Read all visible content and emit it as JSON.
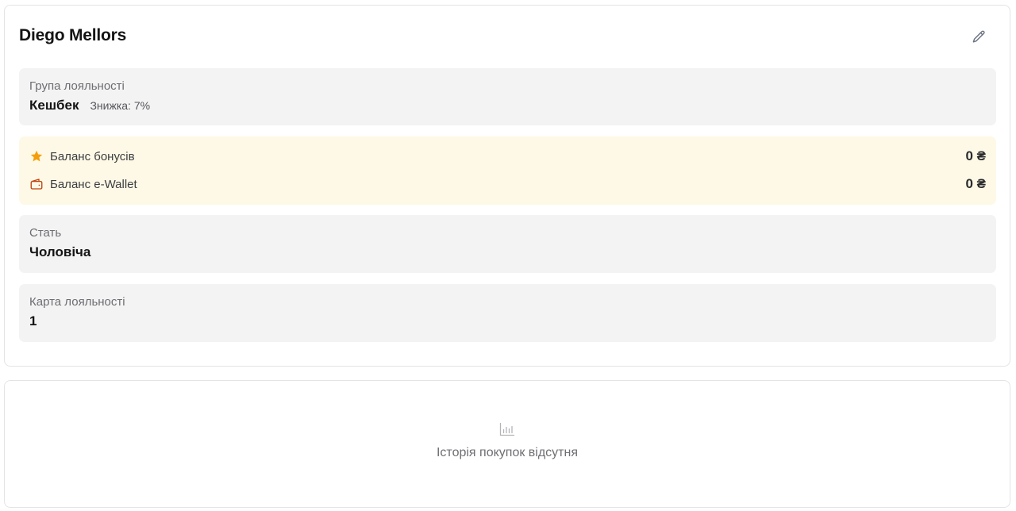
{
  "customer": {
    "name": "Diego Mellors",
    "edit_icon": "pencil-icon"
  },
  "loyalty_group": {
    "label": "Група лояльності",
    "value": "Кешбек",
    "discount": "Знижка: 7%"
  },
  "balances": {
    "bonus": {
      "icon": "star-icon",
      "label": "Баланс бонусів",
      "amount": "0 ₴"
    },
    "ewallet": {
      "icon": "wallet-icon",
      "label": "Баланс e-Wallet",
      "amount": "0 ₴"
    }
  },
  "gender": {
    "label": "Стать",
    "value": "Чоловіча"
  },
  "loyalty_card": {
    "label": "Карта лояльності",
    "value": "1"
  },
  "purchase_history": {
    "icon": "bar-chart-icon",
    "empty_message": "Історія покупок відсутня"
  },
  "colors": {
    "star": "#f59e0b",
    "wallet": "#c2410c",
    "balance_bg": "#fdf9e6",
    "field_bg": "#f3f3f4"
  }
}
